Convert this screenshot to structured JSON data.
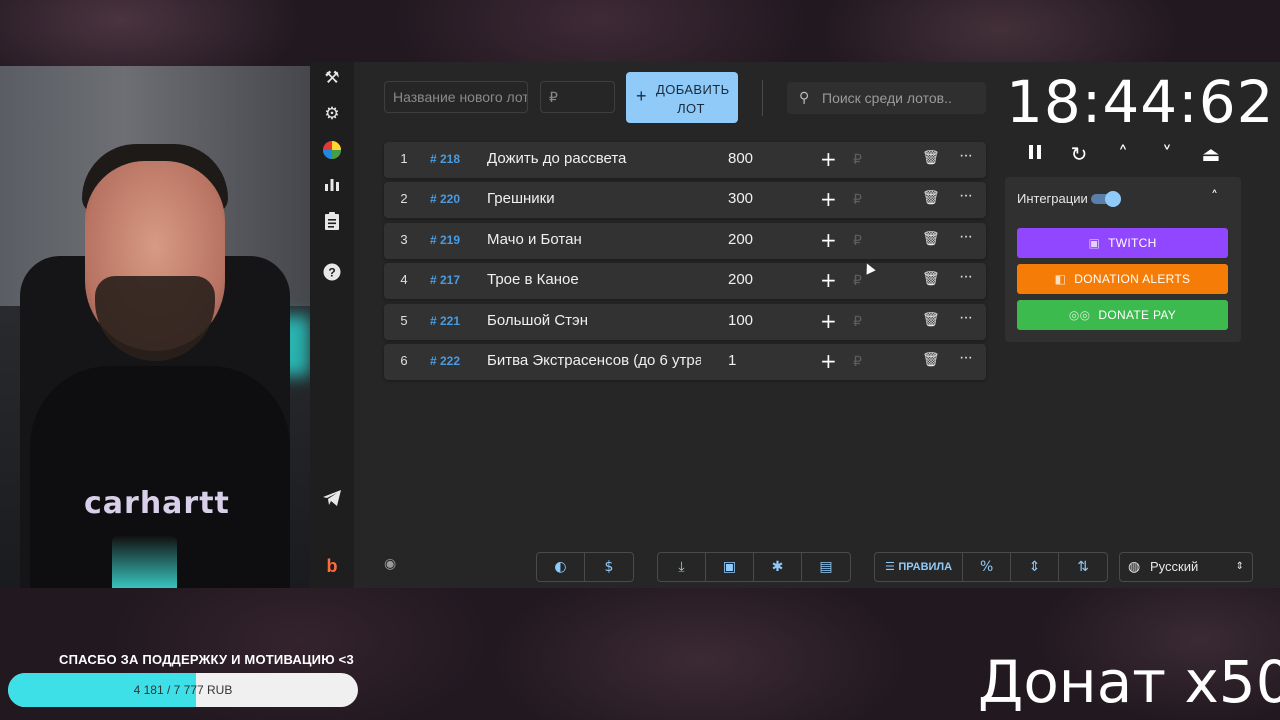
{
  "stream": {
    "webcam_shirt_text": "carhartt",
    "thanks_text": "СПАСБО ЗА ПОДДЕРЖКУ И МОТИВАЦИЮ <3",
    "goal_text": "4 181 / 7 777 RUB",
    "goal_progress": 0.538,
    "donate_text": "Донат x50"
  },
  "sidebar": {
    "items": [
      {
        "icon": "gavel-icon"
      },
      {
        "icon": "gear-icon"
      },
      {
        "icon": "pie-chart-icon"
      },
      {
        "icon": "bar-chart-icon"
      },
      {
        "icon": "clipboard-icon"
      },
      {
        "icon": "help-icon"
      },
      {
        "icon": "telegram-icon"
      },
      {
        "icon": "brand-logo-icon"
      }
    ]
  },
  "toolbar": {
    "new_lot_placeholder": "Название нового лота",
    "amount_placeholder": "₽",
    "add_button_plus": "+",
    "add_button_label": "ДОБАВИТЬ ЛОТ",
    "search_placeholder": "Поиск среди лотов.."
  },
  "lots": [
    {
      "num": "1",
      "id": "# 218",
      "name": "Дожить до рассвета",
      "amount": "800"
    },
    {
      "num": "2",
      "id": "# 220",
      "name": "Грешники",
      "amount": "300"
    },
    {
      "num": "3",
      "id": "# 219",
      "name": "Мачо и Ботан",
      "amount": "200"
    },
    {
      "num": "4",
      "id": "# 217",
      "name": "Трое в Каное",
      "amount": "200"
    },
    {
      "num": "5",
      "id": "# 221",
      "name": "Большой Стэн",
      "amount": "100"
    },
    {
      "num": "6",
      "id": "# 222",
      "name": "Битва Экстрасенсов (до 6 утра)",
      "amount": "1"
    }
  ],
  "lot_actions": {
    "plus": "+",
    "currency": "₽",
    "delete": "🗑",
    "more": "···"
  },
  "timer": {
    "value": "18:44:62"
  },
  "integrations": {
    "label": "Интеграции",
    "enabled": true,
    "twitch": {
      "label": "TWITCH",
      "color": "#9146ff"
    },
    "donation_alerts": {
      "label": "DONATION ALERTS",
      "color": "#f57d07"
    },
    "donate_pay": {
      "label": "DONATE PAY",
      "color": "#3dba4e"
    }
  },
  "bottom": {
    "rules_label": "ПРАВИЛА",
    "language": "Русский"
  },
  "colors": {
    "accent": "#90caf9",
    "id_link": "#4a9be0",
    "background": "#262626"
  }
}
